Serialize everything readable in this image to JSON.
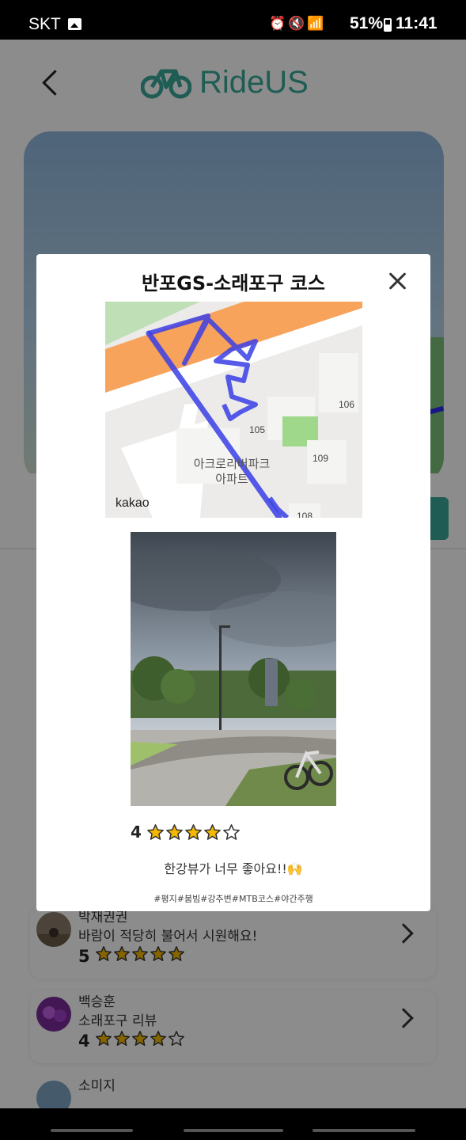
{
  "status_bar": {
    "carrier": "SKT",
    "battery": "51%",
    "time": "11:41",
    "icons": [
      "image-icon",
      "alarm-icon",
      "mute-icon",
      "wifi-icon",
      "signal-icon",
      "battery-icon"
    ]
  },
  "header": {
    "app_name": "RideUS",
    "brand_color": "#3aa99a"
  },
  "reviews": [
    {
      "name": "박재권권",
      "text": "바람이 적당히 불어서 시원해요!",
      "score": "5",
      "rating": 5
    },
    {
      "name": "백승훈",
      "text": "소래포구 리뷰",
      "score": "4",
      "rating": 4
    },
    {
      "name": "소미지",
      "text": "",
      "score": "",
      "rating": 0
    }
  ],
  "modal": {
    "title": "반포GS-소래포구 코스",
    "map": {
      "watermark": "kakao",
      "apartment_label": [
        "아크로리버파크",
        "아파트"
      ],
      "building_numbers": [
        "105",
        "106",
        "109",
        "108"
      ],
      "route_color": "#3a3ee6"
    },
    "rating": {
      "score": "4",
      "value": 4,
      "max": 5
    },
    "comment": "한강뷰가 너무 좋아요!!🙌",
    "tags": "#평지#붐빔#강추변#MTB코스#야간주행"
  }
}
